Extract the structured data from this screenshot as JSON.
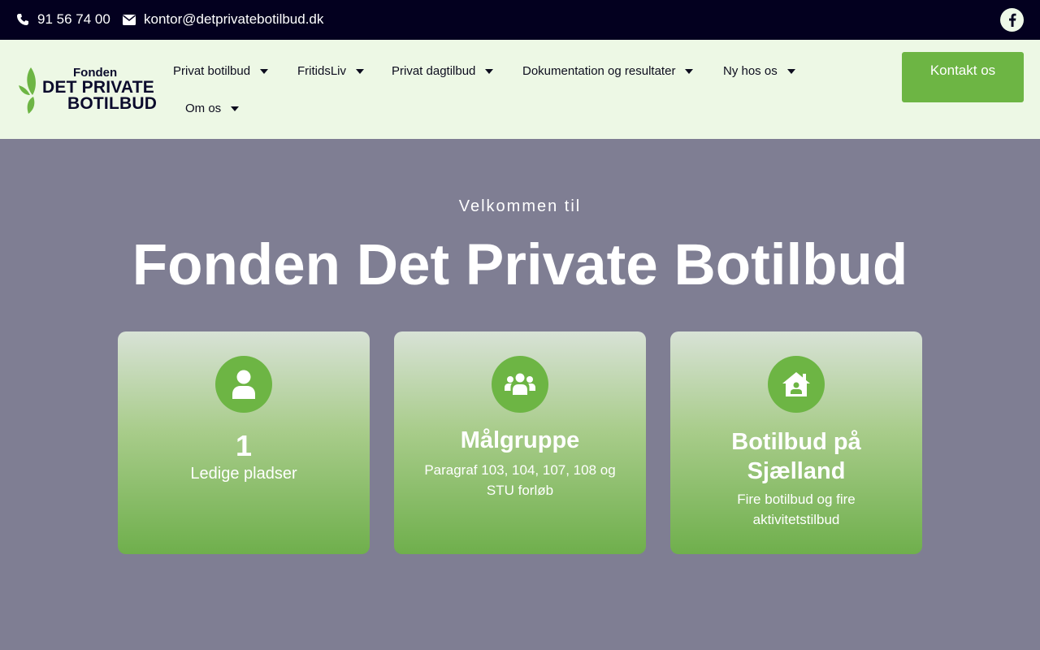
{
  "topbar": {
    "phone": "91 56 74 00",
    "email": "kontor@detprivatebotilbud.dk",
    "social_icon": "facebook-icon"
  },
  "logo": {
    "line1": "Fonden",
    "line2": "DET PRIVATE",
    "line3": "BOTILBUD"
  },
  "nav": {
    "items": [
      {
        "label": "Privat botilbud"
      },
      {
        "label": "FritidsLiv"
      },
      {
        "label": "Privat dagtilbud"
      },
      {
        "label": "Dokumentation og resultater"
      },
      {
        "label": "Ny hos os"
      },
      {
        "label": "Om os"
      }
    ],
    "cta_label": "Kontakt os"
  },
  "hero": {
    "subtitle": "Velkommen til",
    "title": "Fonden Det Private Botilbud"
  },
  "cards": [
    {
      "icon": "user-icon",
      "heading": "1",
      "text": "Ledige pladser"
    },
    {
      "icon": "users-icon",
      "heading": "Målgruppe",
      "text": "Paragraf 103, 104, 107, 108 og STU forløb"
    },
    {
      "icon": "house-user-icon",
      "heading": "Botilbud på Sjælland",
      "text": "Fire botilbud og fire aktivitetstilbud"
    }
  ],
  "colors": {
    "topbar_bg": "#03001f",
    "header_bg": "#edf8e5",
    "accent_green": "#6db544",
    "hero_bg": "#7f7e93"
  }
}
